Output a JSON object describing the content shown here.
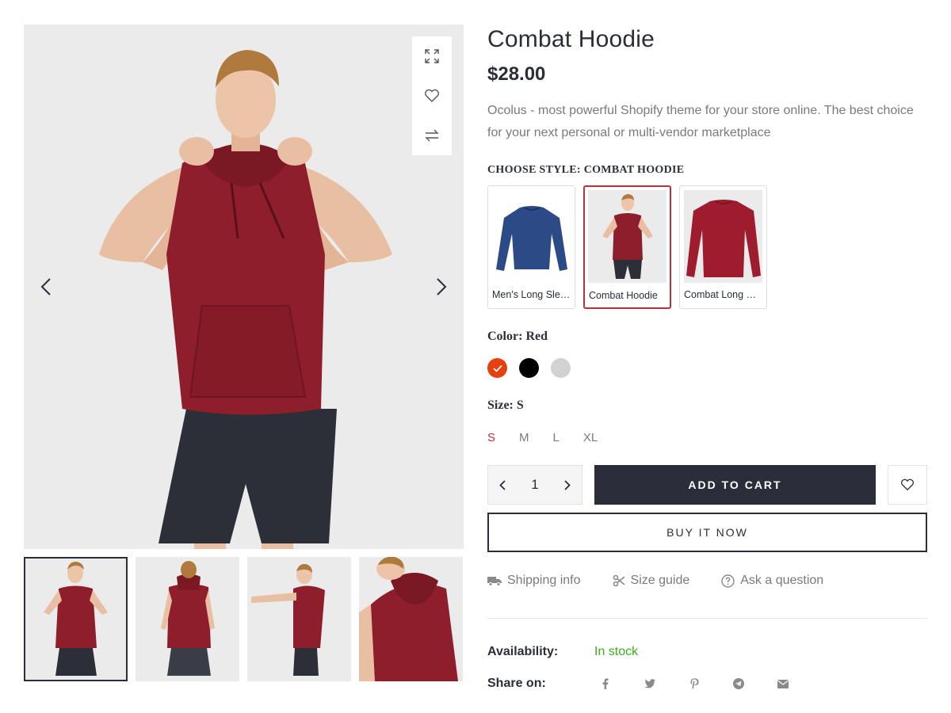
{
  "product": {
    "title": "Combat Hoodie",
    "price": "$28.00",
    "description": "Ocolus - most powerful Shopify theme for your store online. The best choice for your next personal or multi-vendor marketplace"
  },
  "style": {
    "label": "CHOOSE STYLE:",
    "selected": "COMBAT HOODIE",
    "options": [
      {
        "name": "Men's Long Sleeve",
        "color": "#2c4a86"
      },
      {
        "name": "Combat Hoodie",
        "color": "#8e1e2c"
      },
      {
        "name": "Combat Long Sleeve",
        "color": "#9e1c2e"
      }
    ]
  },
  "color": {
    "label": "Color:",
    "selected": "Red",
    "swatches": [
      "#e5400f",
      "#000000",
      "#d2d2d2"
    ]
  },
  "size": {
    "label": "Size:",
    "selected": "S",
    "options": [
      "S",
      "M",
      "L",
      "XL"
    ]
  },
  "cart": {
    "quantity": "1",
    "add_label": "ADD TO CART",
    "buy_label": "BUY IT NOW"
  },
  "links": {
    "shipping": "Shipping info",
    "size_guide": "Size guide",
    "ask": "Ask a question"
  },
  "meta": {
    "availability_label": "Availability:",
    "availability_value": "In stock",
    "share_label": "Share on:"
  },
  "icons": {
    "expand": "expand-icon",
    "wishlist": "heart-icon",
    "compare": "compare-icon",
    "prev": "chevron-left-icon",
    "next": "chevron-right-icon",
    "truck": "truck-icon",
    "scissors": "scissors-icon",
    "question": "question-circle-icon",
    "share": [
      "facebook-icon",
      "twitter-icon",
      "pinterest-icon",
      "telegram-icon",
      "email-icon"
    ]
  },
  "colors": {
    "accent": "#b8313a",
    "dark": "#2b2e3a",
    "in_stock": "#3cae1f",
    "hoodie": "#8e1e2c",
    "gallery_bg": "#ebebeb"
  }
}
